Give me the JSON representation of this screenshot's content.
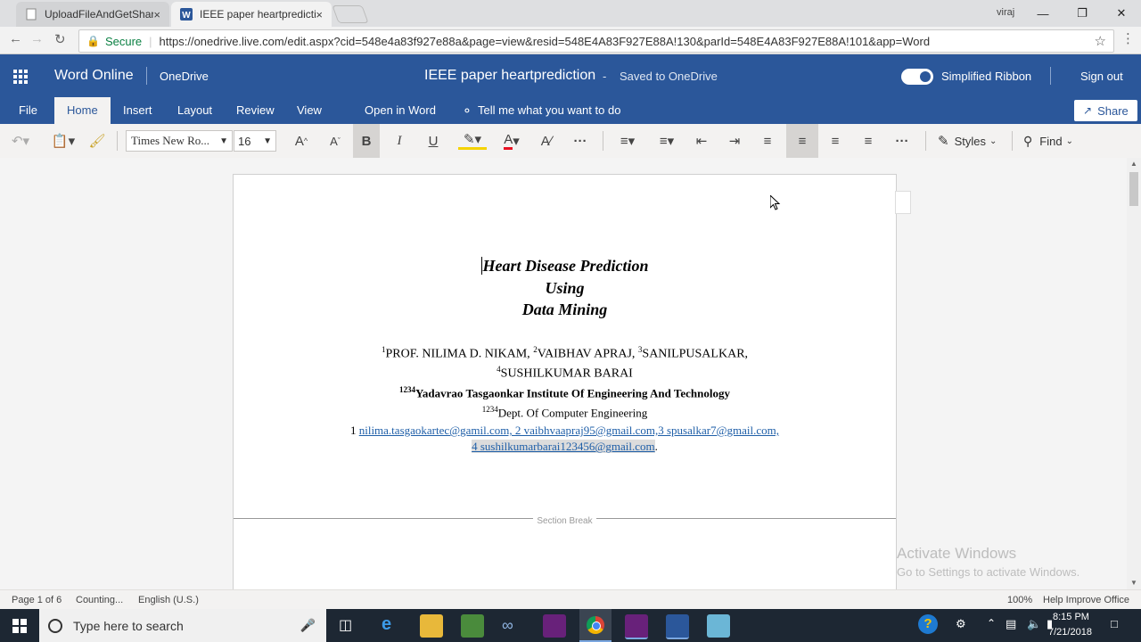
{
  "browser": {
    "tabs": [
      {
        "title": "UploadFileAndGetShareL",
        "close": "×"
      },
      {
        "title": "IEEE paper heartpredictio",
        "close": "×"
      }
    ],
    "user": "viraj",
    "secure_label": "Secure",
    "url": "https://onedrive.live.com/edit.aspx?cid=548e4a83f927e88a&page=view&resid=548E4A83F927E88A!130&parId=548E4A83F927E88A!101&app=Word"
  },
  "word": {
    "app_name": "Word Online",
    "onedrive": "OneDrive",
    "doc_title": "IEEE paper heartprediction",
    "dash": "-",
    "save_status": "Saved to OneDrive",
    "ribbon_toggle_label": "Simplified Ribbon",
    "sign_out": "Sign out",
    "share": "Share",
    "tabs": [
      "File",
      "Home",
      "Insert",
      "Layout",
      "Review",
      "View",
      "Open in Word"
    ],
    "tell_me": "Tell me what you want to do",
    "font_name": "Times New Ro...",
    "font_size": "16",
    "styles": "Styles",
    "find": "Find",
    "more": "···"
  },
  "document": {
    "title_lines": [
      "Heart Disease Prediction",
      "Using",
      "Data Mining"
    ],
    "authors_line1": {
      "s1": "1",
      "a1": "PROF. NILIMA D. NIKAM, ",
      "s2": "2",
      "a2": "VAIBHAV APRAJ, ",
      "s3": "3",
      "a3": "SANILPUSALKAR,"
    },
    "authors_line2": {
      "s4": "4",
      "a4": "SUSHILKUMAR BARAI"
    },
    "institute": {
      "sup": "1234",
      "text": "Yadavrao Tasgaonkar Institute Of Engineering And Technology"
    },
    "dept": {
      "sup": "1234",
      "text": "Dept. Of Computer Engineering"
    },
    "emails_line1": {
      "prefix": "1 ",
      "links": "nilima.tasgaokartec@gamil.com, 2 vaibhvaapraj95@gmail.com,3 spusalkar7@gmail.com,"
    },
    "emails_line2": {
      "link": "4 sushilkumarbarai123456@gmail.com",
      "suffix": "."
    },
    "section_break": "Section Break"
  },
  "status": {
    "page": "Page 1 of 6",
    "counting": "Counting...",
    "language": "English (U.S.)",
    "zoom": "100%",
    "help": "Help Improve Office"
  },
  "watermark": {
    "line1": "Activate Windows",
    "line2": "Go to Settings to activate Windows."
  },
  "taskbar": {
    "search_placeholder": "Type here to search",
    "time": "8:15 PM",
    "date": "7/21/2018"
  },
  "colors": {
    "word_blue": "#2b579a",
    "taskbar": "#1d2733"
  }
}
